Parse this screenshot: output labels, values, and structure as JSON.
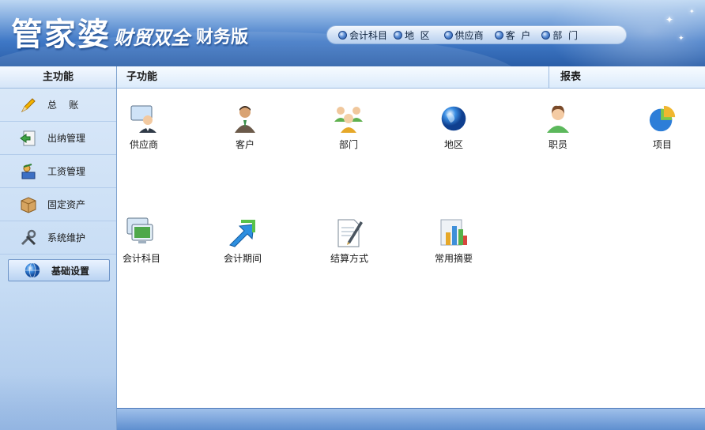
{
  "header": {
    "brand_main": "管家婆",
    "brand_sub": "财贸双全",
    "brand_edition": "财务版",
    "quick_links": [
      {
        "label": "会计科目",
        "icon": "radio-dot-icon"
      },
      {
        "label": "地  区",
        "icon": "radio-dot-icon"
      },
      {
        "label": "供应商",
        "icon": "radio-dot-icon"
      },
      {
        "label": "客  户",
        "icon": "radio-dot-icon"
      },
      {
        "label": "部  门",
        "icon": "radio-dot-icon"
      }
    ]
  },
  "sidebar": {
    "title": "主功能",
    "items": [
      {
        "label": "总    账",
        "icon": "pencil-icon"
      },
      {
        "label": "出纳管理",
        "icon": "cashier-icon"
      },
      {
        "label": "工资管理",
        "icon": "payroll-icon"
      },
      {
        "label": "固定资产",
        "icon": "box-icon"
      },
      {
        "label": "系统维护",
        "icon": "tools-icon"
      },
      {
        "label": "基础设置",
        "icon": "globe-icon",
        "active": true
      }
    ]
  },
  "main": {
    "subfunction_title": "子功能",
    "report_title": "报表",
    "functions": [
      {
        "label": "供应商",
        "icon": "supplier-icon"
      },
      {
        "label": "客户",
        "icon": "customer-icon"
      },
      {
        "label": "部门",
        "icon": "department-icon"
      },
      {
        "label": "地区",
        "icon": "globe-icon"
      },
      {
        "label": "职员",
        "icon": "employee-icon"
      },
      {
        "label": "项目",
        "icon": "pie-chart-icon"
      },
      {
        "label": "会计科目",
        "icon": "monitor-icon"
      },
      {
        "label": "会计期间",
        "icon": "arrows-icon"
      },
      {
        "label": "结算方式",
        "icon": "document-pen-icon"
      },
      {
        "label": "常用摘要",
        "icon": "bar-chart-icon"
      }
    ]
  },
  "colors": {
    "header_dark": "#2a5ea8",
    "header_light": "#bcd6f2",
    "sidebar_bg": "#c6dcf4",
    "accent": "#1f4f9f"
  }
}
